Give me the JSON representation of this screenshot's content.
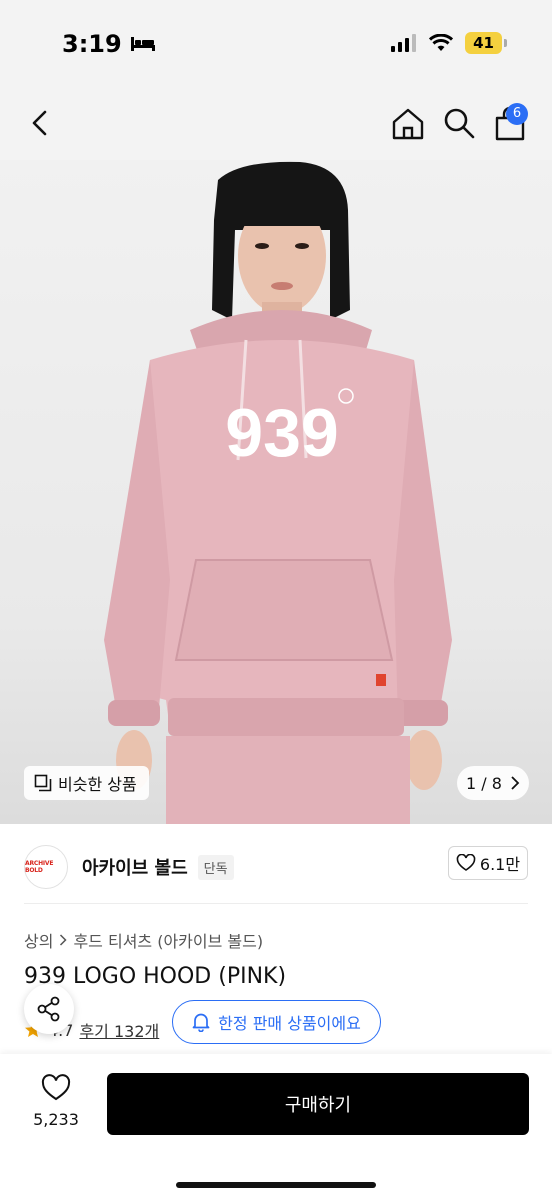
{
  "status_bar": {
    "time": "3:19",
    "battery": "41",
    "icons": [
      "bed-icon",
      "signal-icon",
      "wifi-icon",
      "battery-icon"
    ]
  },
  "nav": {
    "back_icon": "chevron-left-icon",
    "home_icon": "home-icon",
    "search_icon": "search-icon",
    "cart_icon": "shopping-bag-icon",
    "cart_badge": "6"
  },
  "hero": {
    "similar_label": "비슷한 상품",
    "pager": "1 / 8",
    "print_text": "939"
  },
  "brand": {
    "logo_text": "ARCHIVE BOLD",
    "name": "아카이브 볼드",
    "exclusive_tag": "단독",
    "likes": "6.1만"
  },
  "product": {
    "breadcrumb": [
      "상의",
      "후드 티셔츠 (아카이브 볼드)"
    ],
    "title": "939 LOGO HOOD (PINK)",
    "rating": "4.7",
    "reviews": "후기 132개",
    "limited_label": "한정 판매 상품이에요"
  },
  "bottom_bar": {
    "heart_count": "5,233",
    "buy_label": "구매하기"
  },
  "colors": {
    "accent_blue": "#2b6ef5",
    "buy_button": "#000000",
    "hoodie_pink": "#e8b8bf",
    "star": "#f2a300"
  }
}
